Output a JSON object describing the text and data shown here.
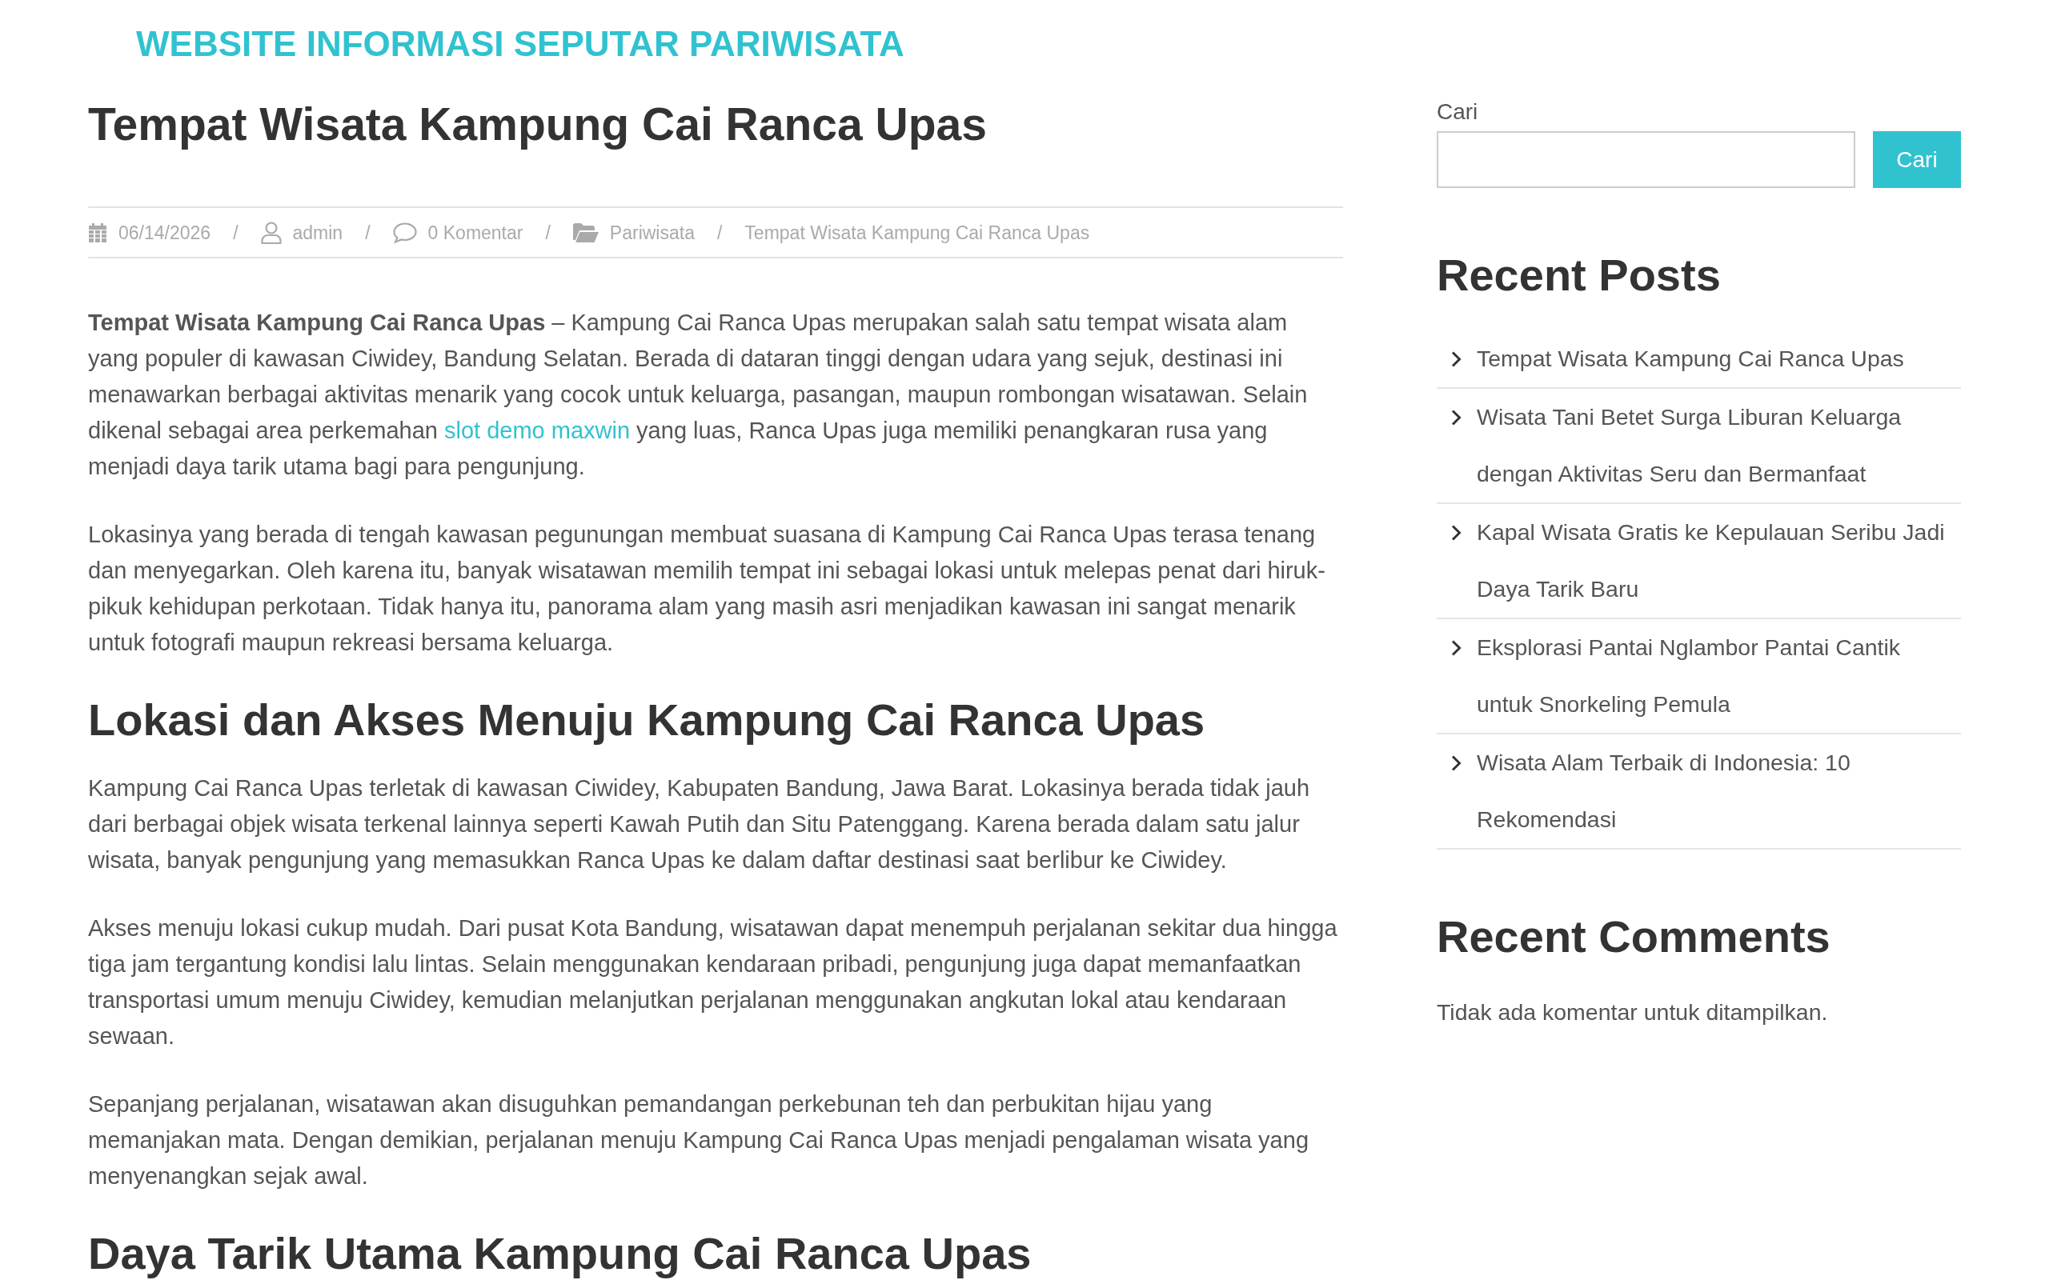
{
  "site_title": "WEBSITE INFORMASI SEPUTAR PARIWISATA",
  "article": {
    "title": "Tempat Wisata Kampung Cai Ranca Upas",
    "meta": [
      {
        "kind": "date",
        "text": "06/14/2026"
      },
      {
        "kind": "separator",
        "text": "/"
      },
      {
        "kind": "author",
        "text": "admin"
      },
      {
        "kind": "separator",
        "text": "/"
      },
      {
        "kind": "comments",
        "text": "0 Komentar"
      },
      {
        "kind": "separator",
        "text": "/"
      },
      {
        "kind": "category",
        "text": "Pariwisata"
      },
      {
        "kind": "separator",
        "text": "/"
      },
      {
        "kind": "breadcrumb",
        "text": "Tempat Wisata Kampung Cai Ranca Upas"
      }
    ],
    "content": [
      {
        "kind": "paragraph",
        "segments": [
          {
            "kind": "text",
            "text": "**Tempat Wisata Kampung Cai Ranca Upas** – Kampung Cai Ranca Upas merupakan salah satu tempat wisata alam yang populer di kawasan Ciwidey, Bandung Selatan. Berada di dataran tinggi dengan udara yang sejuk, destinasi ini menawarkan berbagai aktivitas menarik yang cocok untuk keluarga, pasangan, maupun rombongan wisatawan. Selain dikenal sebagai area perkemahan "
          },
          {
            "kind": "link",
            "text": "slot demo maxwin"
          },
          {
            "kind": "text",
            "text": " yang luas, Ranca Upas juga memiliki penangkaran rusa yang menjadi daya tarik utama bagi para pengunjung."
          }
        ]
      },
      {
        "kind": "paragraph",
        "segments": [
          {
            "kind": "text",
            "text": "Lokasinya yang berada di tengah kawasan pegunungan membuat suasana di Kampung Cai Ranca Upas terasa tenang dan menyegarkan. Oleh karena itu, banyak wisatawan memilih tempat ini sebagai lokasi untuk melepas penat dari hiruk-pikuk kehidupan perkotaan. Tidak hanya itu, panorama alam yang masih asri menjadikan kawasan ini sangat menarik untuk fotografi maupun rekreasi bersama keluarga."
          }
        ]
      },
      {
        "kind": "heading",
        "text": "Lokasi dan Akses Menuju Kampung Cai Ranca Upas"
      },
      {
        "kind": "paragraph",
        "segments": [
          {
            "kind": "text",
            "text": "Kampung Cai Ranca Upas terletak di kawasan Ciwidey, Kabupaten Bandung, Jawa Barat. Lokasinya berada tidak jauh dari berbagai objek wisata terkenal lainnya seperti Kawah Putih dan Situ Patenggang. Karena berada dalam satu jalur wisata, banyak pengunjung yang memasukkan Ranca Upas ke dalam daftar destinasi saat berlibur ke Ciwidey."
          }
        ]
      },
      {
        "kind": "paragraph",
        "segments": [
          {
            "kind": "text",
            "text": "Akses menuju lokasi cukup mudah. Dari pusat Kota Bandung, wisatawan dapat menempuh perjalanan sekitar dua hingga tiga jam tergantung kondisi lalu lintas. Selain menggunakan kendaraan pribadi, pengunjung juga dapat memanfaatkan transportasi umum menuju Ciwidey, kemudian melanjutkan perjalanan menggunakan angkutan lokal atau kendaraan sewaan."
          }
        ]
      },
      {
        "kind": "paragraph",
        "segments": [
          {
            "kind": "text",
            "text": "Sepanjang perjalanan, wisatawan akan disuguhkan pemandangan perkebunan teh dan perbukitan hijau yang memanjakan mata. Dengan demikian, perjalanan menuju Kampung Cai Ranca Upas menjadi pengalaman wisata yang menyenangkan sejak awal."
          }
        ]
      },
      {
        "kind": "heading",
        "text": "Daya Tarik Utama Kampung Cai Ranca Upas"
      }
    ]
  },
  "sidebar": {
    "search": {
      "label": "Cari",
      "button": "Cari"
    },
    "recent_posts": {
      "title": "Recent Posts",
      "items": [
        "Tempat Wisata Kampung Cai Ranca Upas",
        "Wisata Tani Betet Surga Liburan Keluarga dengan Aktivitas Seru dan Bermanfaat",
        "Kapal Wisata Gratis ke Kepulauan Seribu Jadi Daya Tarik Baru",
        "Eksplorasi Pantai Nglambor Pantai Cantik untuk Snorkeling Pemula",
        "Wisata Alam Terbaik di Indonesia: 10 Rekomendasi"
      ]
    },
    "recent_comments": {
      "title": "Recent Comments",
      "text": "Tidak ada komentar untuk ditampilkan."
    }
  }
}
